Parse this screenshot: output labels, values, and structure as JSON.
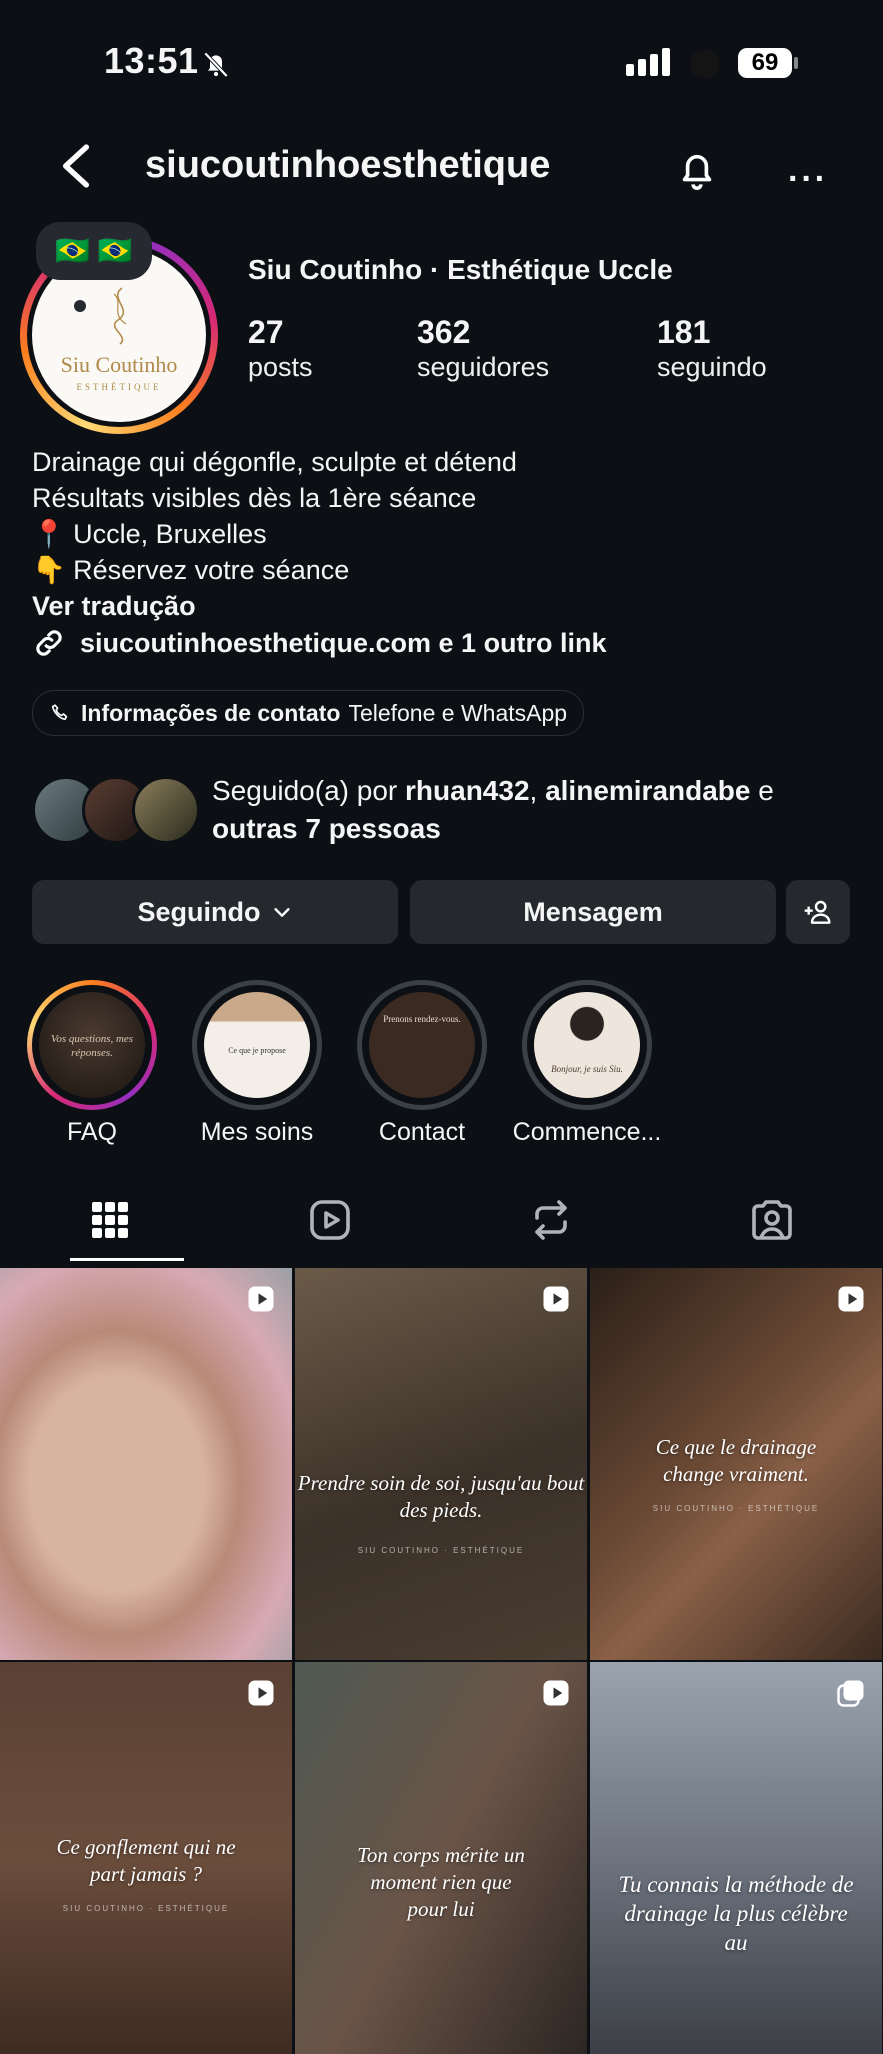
{
  "status_bar": {
    "time": "13:51",
    "battery": "69"
  },
  "header": {
    "username": "siucoutinhoesthetique"
  },
  "profile": {
    "note_flags": "🇧🇷 🇧🇷",
    "avatar_logo_name": "Siu Coutinho",
    "avatar_logo_sub": "ESTHÉTIQUE",
    "display_name": "Siu Coutinho · Esthétique Uccle",
    "stats": [
      {
        "value": "27",
        "label": "posts"
      },
      {
        "value": "362",
        "label": "seguidores"
      },
      {
        "value": "181",
        "label": "seguindo"
      }
    ],
    "bio": [
      "Drainage qui dégonfle, sculpte et détend",
      "Résultats visibles dès la 1ère séance",
      "📍 Uccle, Bruxelles",
      "👇 Réservez votre séance"
    ],
    "translate": "Ver tradução",
    "link": "siucoutinhoesthetique.com e 1 outro link",
    "contact": {
      "label": "Informações de contato",
      "detail": "Telefone e WhatsApp"
    },
    "followed_by": {
      "prefix": "Seguido(a) por ",
      "user1": "rhuan432",
      "sep": ", ",
      "user2": "alinemirandabe",
      "and": " e",
      "others": "outras 7 pessoas"
    }
  },
  "buttons": {
    "following": "Seguindo",
    "message": "Mensagem"
  },
  "highlights": [
    {
      "label": "FAQ",
      "cover_text": "Vos questions, mes réponses."
    },
    {
      "label": "Mes soins",
      "cover_text": "Ce que je propose"
    },
    {
      "label": "Contact",
      "cover_text": "Prenons rendez-vous."
    },
    {
      "label": "Commence...",
      "cover_text": "Bonjour, je suis Siu."
    }
  ],
  "tabs": [
    "grid-icon",
    "reels-icon",
    "reposts-icon",
    "tagged-icon"
  ],
  "grid": [
    {
      "caption": "",
      "sub": ""
    },
    {
      "caption": "Prendre soin de soi, jusqu'au bout des pieds.",
      "sub": "SIU COUTINHO · ESTHÉTIQUE"
    },
    {
      "caption": "Ce que le drainage change vraiment.",
      "sub": "SIU COUTINHO · ESTHÉTIQUE"
    },
    {
      "caption": "Ce gonflement qui ne part jamais ?",
      "sub": "SIU COUTINHO · ESTHÉTIQUE"
    },
    {
      "caption": "Ton corps mérite un moment rien que pour lui",
      "sub": ""
    },
    {
      "caption": "Tu connais la méthode de drainage la plus célèbre au",
      "sub": ""
    }
  ],
  "colors": {
    "background": "#0c1014",
    "button": "#25292e",
    "text": "#f5f5f5"
  }
}
